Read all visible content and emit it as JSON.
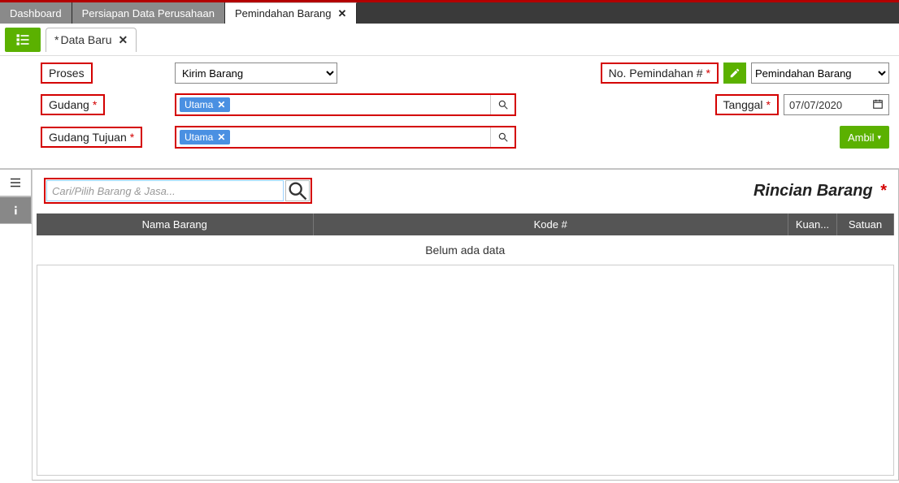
{
  "tabs": {
    "dashboard": "Dashboard",
    "persiapan": "Persiapan Data Perusahaan",
    "pemindahan": "Pemindahan Barang"
  },
  "subtab": {
    "label": "Data Baru",
    "prefix": "*"
  },
  "form": {
    "proses_label": "Proses",
    "proses_value": "Kirim Barang",
    "gudang_label": "Gudang",
    "gudang_value": "Utama",
    "gudang_tujuan_label": "Gudang Tujuan",
    "gudang_tujuan_value": "Utama",
    "no_pemindahan_label": "No. Pemindahan #",
    "no_type_value": "Pemindahan Barang",
    "tanggal_label": "Tanggal",
    "tanggal_value": "07/07/2020",
    "ambil_label": "Ambil"
  },
  "detail": {
    "search_placeholder": "Cari/Pilih Barang & Jasa...",
    "section_title": "Rincian Barang",
    "columns": {
      "nama": "Nama Barang",
      "kode": "Kode #",
      "kuan": "Kuan...",
      "satuan": "Satuan"
    },
    "empty": "Belum ada data"
  }
}
